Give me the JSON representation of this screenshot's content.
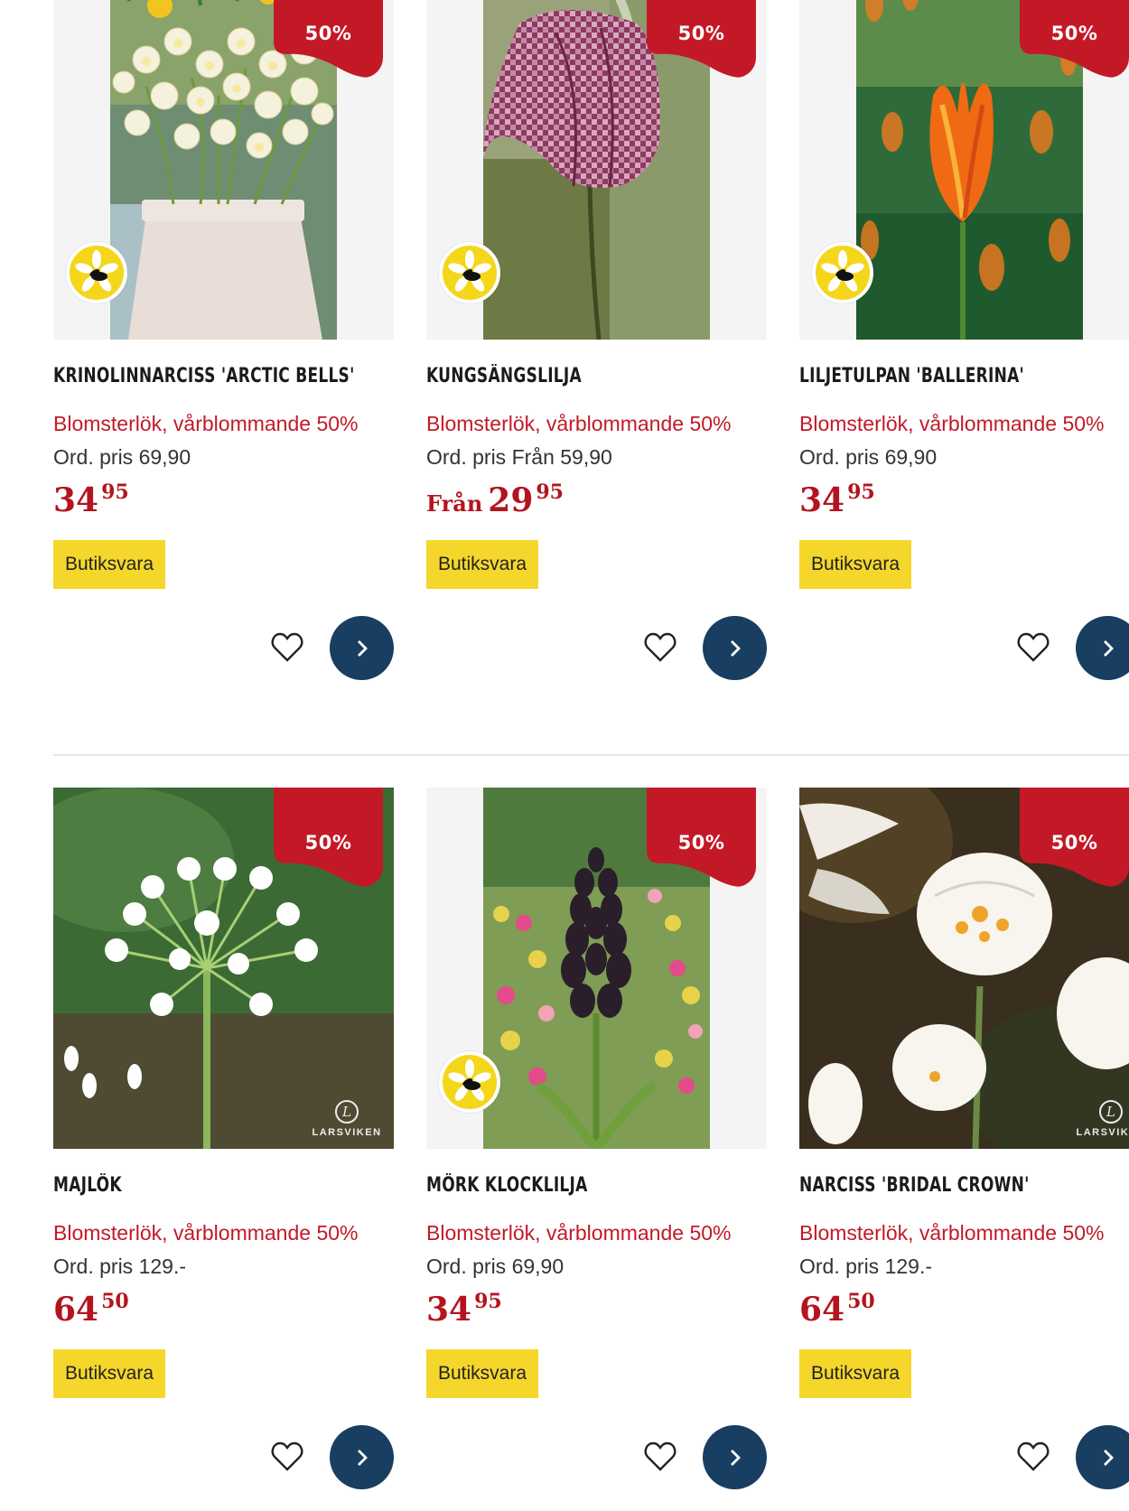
{
  "colors": {
    "accent": "#c31927",
    "button": "#183e62",
    "tag": "#f5d72b"
  },
  "labels": {
    "discount": "50%",
    "stock": "Butiksvara",
    "brand": "LARSVIKEN",
    "brand_mark": "L"
  },
  "products": [
    {
      "name": "KRINOLINNARCISS 'ARCTIC BELLS'",
      "subtitle": "Blomsterlök, vårblommande 50%",
      "ord_price": "Ord. pris 69,90",
      "from": "",
      "price_int": "34",
      "price_dec": "95",
      "bee_icon": "bee-friendly-icon"
    },
    {
      "name": "KUNGSÄNGSLILJA",
      "subtitle": "Blomsterlök, vårblommande 50%",
      "ord_price": "Ord. pris Från 59,90",
      "from": "Från",
      "price_int": "29",
      "price_dec": "95",
      "bee_icon": "bee-friendly-icon"
    },
    {
      "name": "LILJETULPAN 'BALLERINA'",
      "subtitle": "Blomsterlök, vårblommande 50%",
      "ord_price": "Ord. pris 69,90",
      "from": "",
      "price_int": "34",
      "price_dec": "95",
      "bee_icon": "bee-friendly-icon"
    },
    {
      "name": "MAJLÖK",
      "subtitle": "Blomsterlök, vårblommande 50%",
      "ord_price": "Ord. pris 129.-",
      "from": "",
      "price_int": "64",
      "price_dec": "50",
      "brand_logo": "larsviken-logo"
    },
    {
      "name": "MÖRK KLOCKLILJA",
      "subtitle": "Blomsterlök, vårblommande 50%",
      "ord_price": "Ord. pris 69,90",
      "from": "",
      "price_int": "34",
      "price_dec": "95",
      "bee_icon": "bee-friendly-icon"
    },
    {
      "name": "NARCISS 'BRIDAL CROWN'",
      "subtitle": "Blomsterlök, vårblommande 50%",
      "ord_price": "Ord. pris 129.-",
      "from": "",
      "price_int": "64",
      "price_dec": "50",
      "brand_logo": "larsviken-logo"
    }
  ]
}
